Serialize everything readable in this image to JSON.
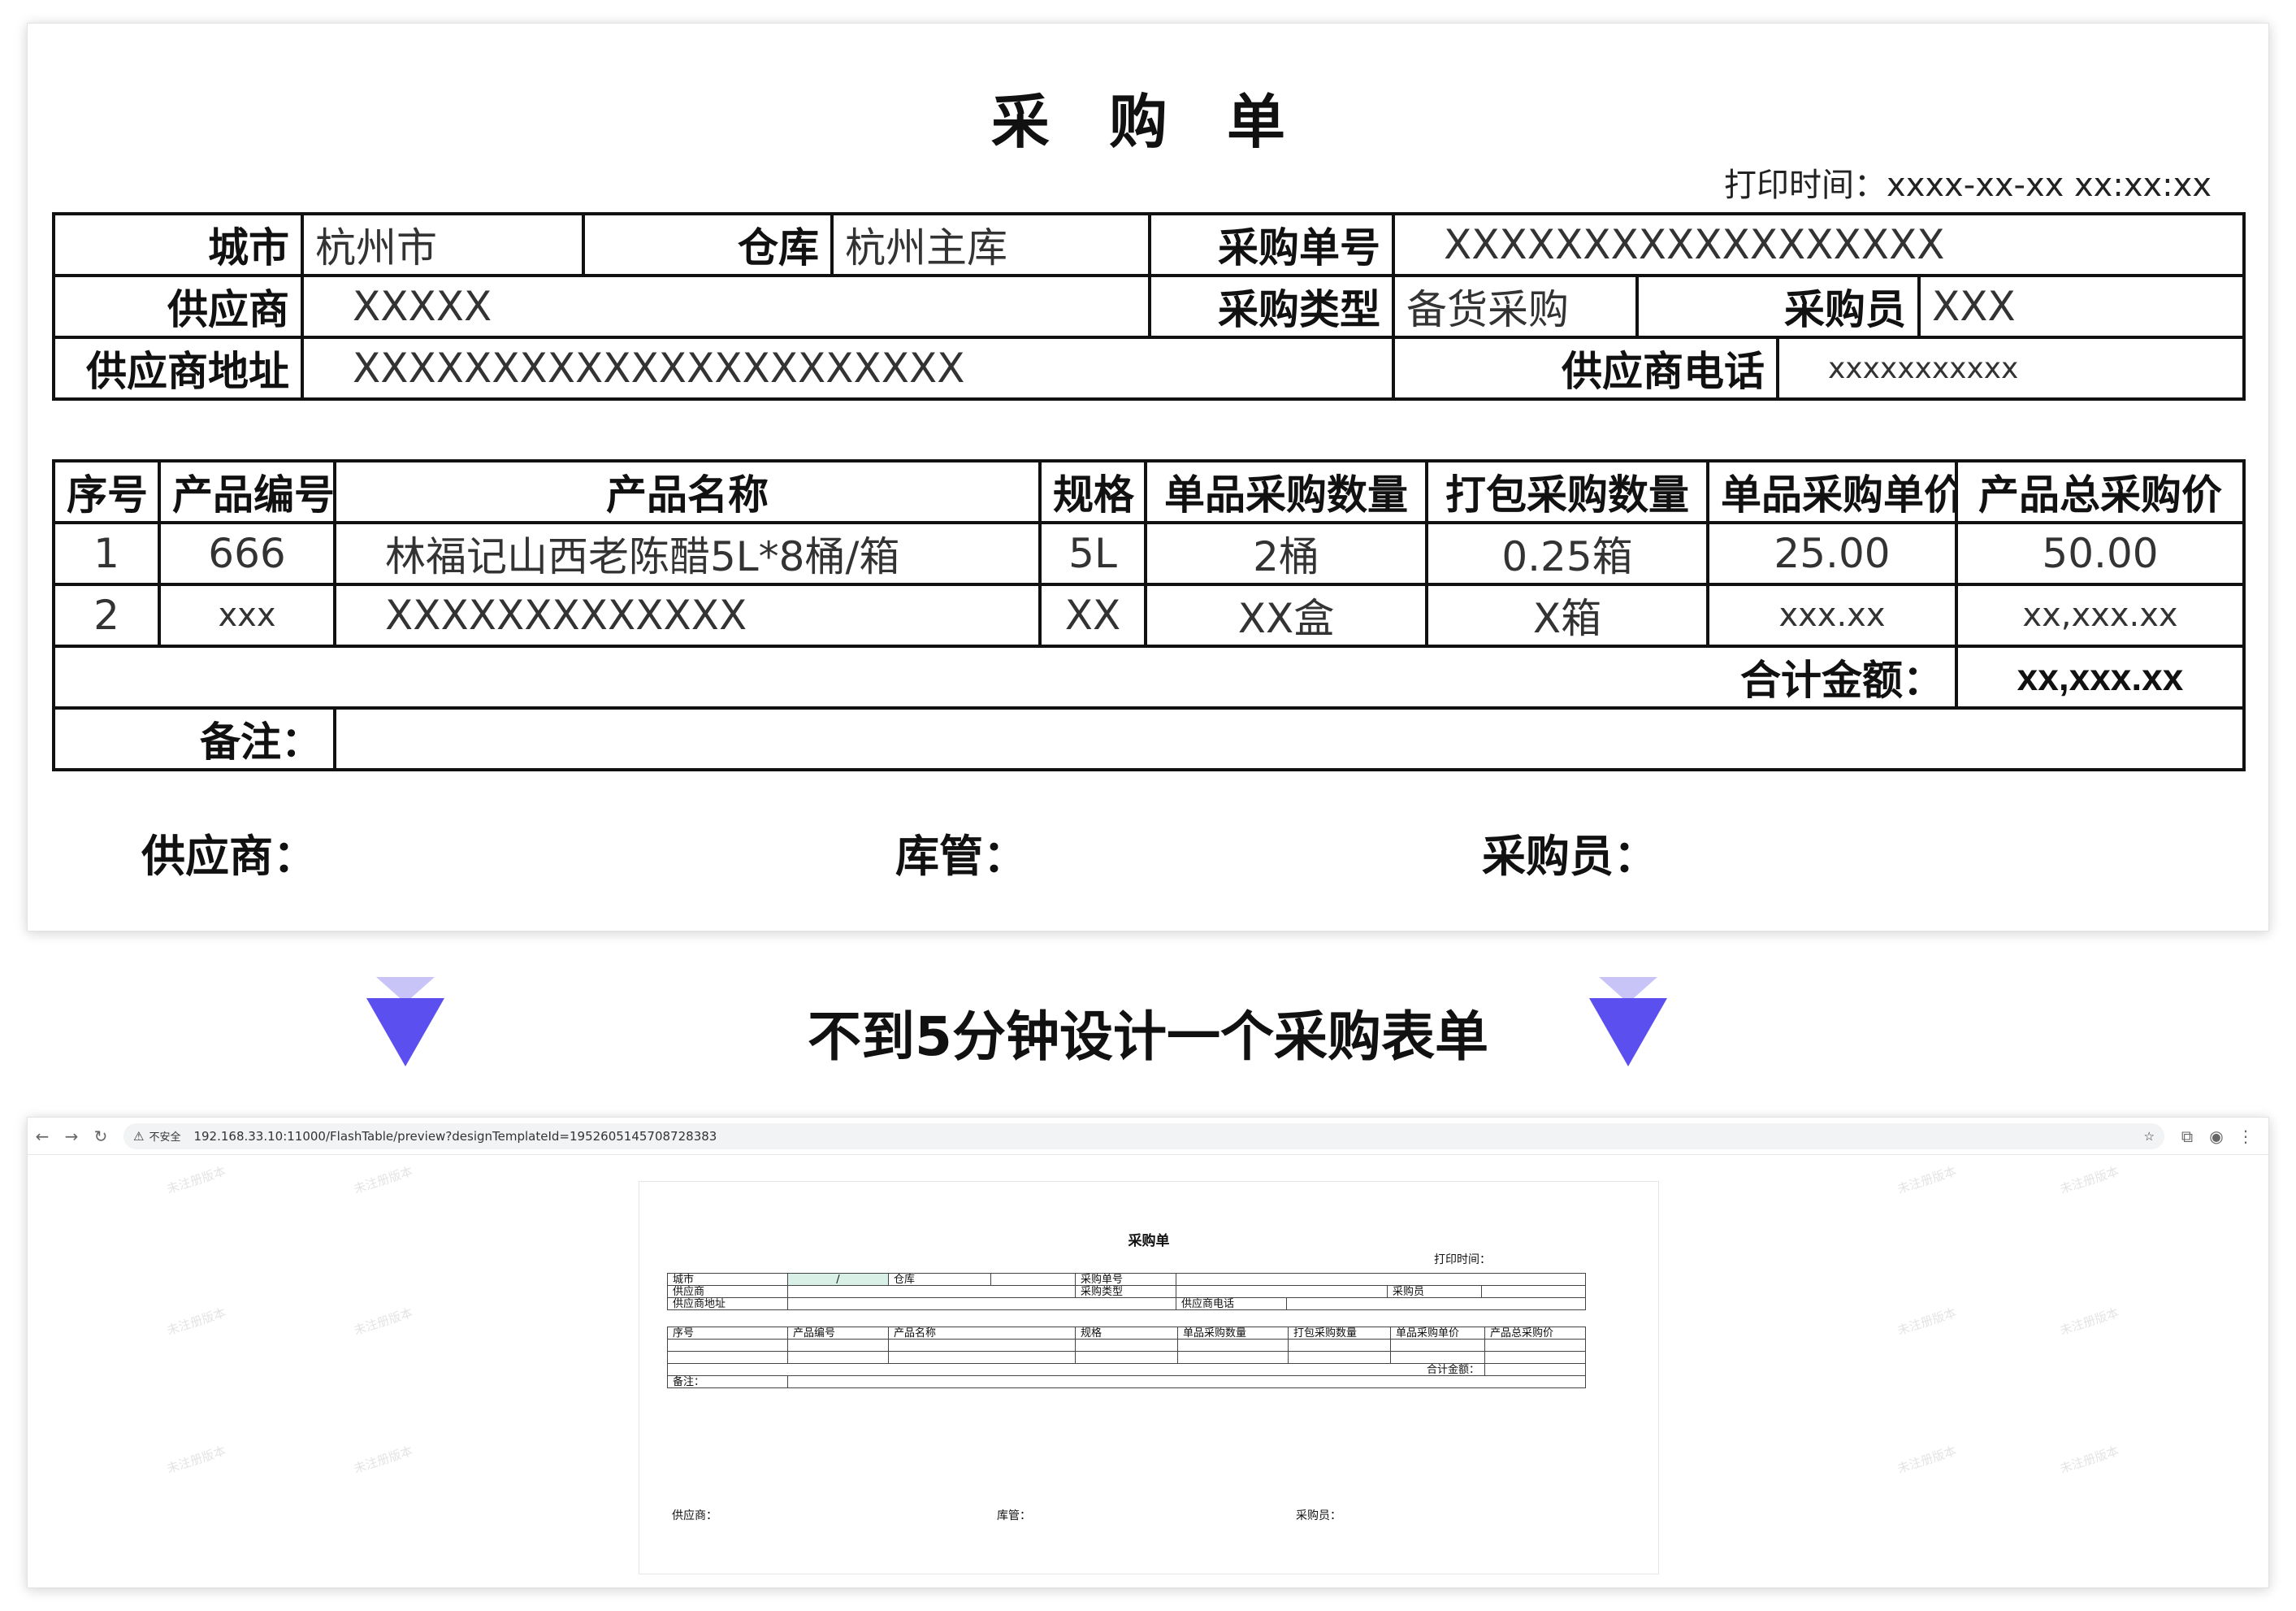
{
  "form": {
    "title": "采 购 单",
    "print_time": "打印时间：xxxx-xx-xx xx:xx:xx",
    "header": {
      "city_label": "城市",
      "city_value": "杭州市",
      "warehouse_label": "仓库",
      "warehouse_value": "杭州主库",
      "order_no_label": "采购单号",
      "order_no_value": "XXXXXXXXXXXXXXXXXX",
      "supplier_label": "供应商",
      "supplier_value": "XXXXX",
      "purchase_type_label": "采购类型",
      "purchase_type_value": "备货采购",
      "buyer_label": "采购员",
      "buyer_value": "XXX",
      "supplier_address_label": "供应商地址",
      "supplier_address_value": "XXXXXXXXXXXXXXXXXXXXXX",
      "supplier_phone_label": "供应商电话",
      "supplier_phone_value": "xxxxxxxxxxx"
    },
    "columns": [
      "序号",
      "产品编号",
      "产品名称",
      "规格",
      "单品采购数量",
      "打包采购数量",
      "单品采购单价",
      "产品总采购价"
    ],
    "rows": [
      [
        "1",
        "666",
        "林福记山西老陈醋5L*8桶/箱",
        "5L",
        "2桶",
        "0.25箱",
        "25.00",
        "50.00"
      ],
      [
        "2",
        "xxx",
        "XXXXXXXXXXXXX",
        "XX",
        "XX盒",
        "X箱",
        "xxx.xx",
        "xx,xxx.xx"
      ]
    ],
    "total_label": "合计金额：",
    "total_value": "xx,xxx.xx",
    "remark_label": "备注：",
    "signatures": {
      "supplier": "供应商：",
      "keeper": "库管：",
      "buyer": "采购员："
    }
  },
  "caption": "不到5分钟设计一个采购表单",
  "colors": {
    "arrow": "#5b4ff0",
    "arrow_light": "#c9c4f7"
  },
  "browser": {
    "insecure_label": "不安全",
    "url": "192.168.33.10:11000/FlashTable/preview?designTemplateId=1952605145708728383",
    "watermark": "未注册版本",
    "icons": [
      "back-icon",
      "forward-icon",
      "reload-icon",
      "warning-icon",
      "star-icon",
      "extensions-icon",
      "profile-icon",
      "menu-icon"
    ],
    "preview": {
      "title": "采购单",
      "print_time": "打印时间：",
      "city": "城市",
      "selected_cell": "/",
      "warehouse": "仓库",
      "order_no": "采购单号",
      "supplier": "供应商",
      "purchase_type": "采购类型",
      "buyer": "采购员",
      "supplier_address": "供应商地址",
      "supplier_phone": "供应商电话",
      "columns": [
        "序号",
        "产品编号",
        "产品名称",
        "规格",
        "单品采购数量",
        "打包采购数量",
        "单品采购单价",
        "产品总采购价"
      ],
      "total_label": "合计金额：",
      "remark_label": "备注：",
      "sign_supplier": "供应商：",
      "sign_keeper": "库管：",
      "sign_buyer": "采购员："
    }
  }
}
